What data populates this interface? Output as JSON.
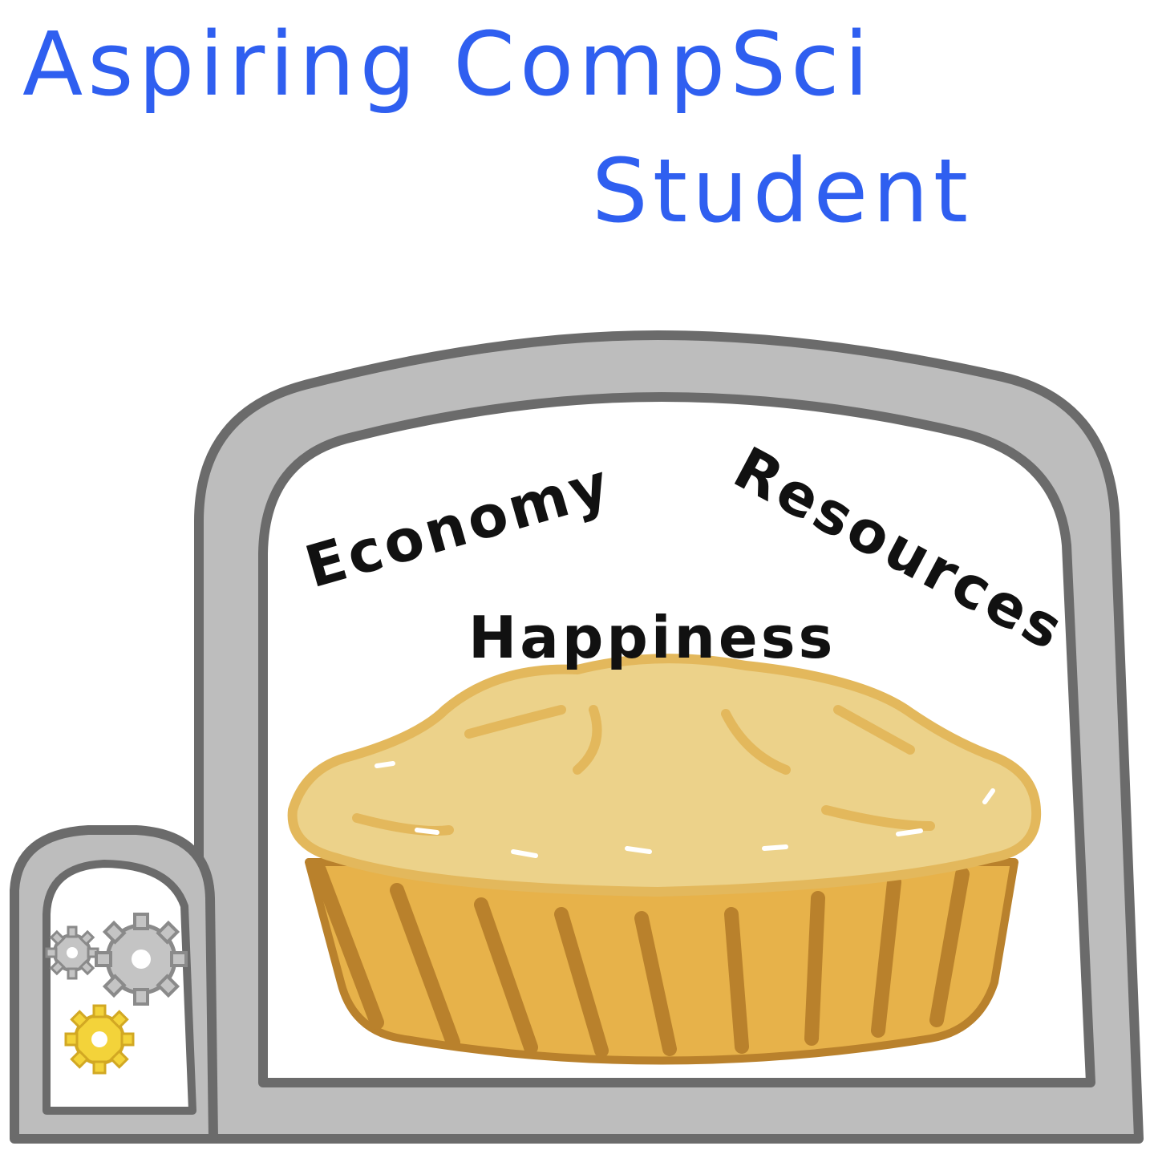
{
  "title": {
    "line1": "Aspiring CompSci",
    "line2": "Student"
  },
  "labels": {
    "economy": "Economy",
    "happiness": "Happiness",
    "resources": "Resources"
  },
  "colors": {
    "title": "#2f5ff0",
    "text": "#111111",
    "oven_fill": "#bdbdbd",
    "oven_outline": "#6b6b6b",
    "crust_top": "#ecd28a",
    "crust_edge": "#e3b85c",
    "dish": "#e7b24a",
    "dish_ribs": "#b9812c",
    "gear_gray": "#c4c4c4",
    "gear_yellow": "#f3d33a"
  },
  "icons": {
    "small_oven": "small-oven-door-icon",
    "gear_1": "gear-icon",
    "gear_2": "gear-icon",
    "gear_3": "gear-icon"
  }
}
